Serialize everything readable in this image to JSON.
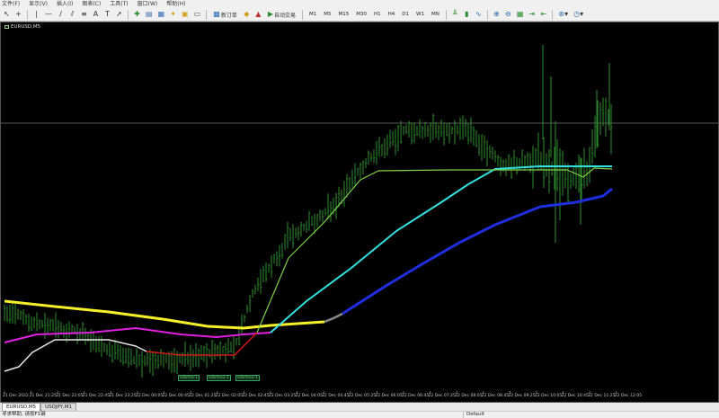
{
  "menu": [
    "文件(F)",
    "显示(V)",
    "插入(I)",
    "图表(C)",
    "工具(T)",
    "窗口(W)",
    "帮助(H)"
  ],
  "toolbar": {
    "new_order_label": "新订单",
    "autotrading_label": "自动交易",
    "periods": [
      "M1",
      "M5",
      "M15",
      "M30",
      "H1",
      "H4",
      "D1",
      "W1",
      "MN"
    ]
  },
  "chart": {
    "title": "EURUSD,M5",
    "time_labels": [
      "21 Dec 2022",
      "21 Dec 21:25",
      "21 Dec 22:05",
      "21 Dec 22:45",
      "21 Dec 23:25",
      "22 Dec 00:05",
      "22 Dec 00:45",
      "22 Dec 01:25",
      "22 Dec 02:05",
      "22 Dec 02:45",
      "22 Dec 03:25",
      "22 Dec 04:05",
      "22 Dec 04:45",
      "22 Dec 05:25",
      "22 Dec 06:05",
      "22 Dec 06:45",
      "22 Dec 07:25",
      "22 Dec 08:05",
      "22 Dec 08:45",
      "22 Dec 09:25",
      "22 Dec 10:05",
      "22 Dec 10:45",
      "22 Dec 11:25",
      "22 Dec 12:05"
    ],
    "object_tags": [
      "sdsrma-1",
      "sdsrma2-1",
      "sdsrma3-1"
    ],
    "colors": {
      "background": "#000000",
      "bars": "#2e8b2e",
      "ma_fast": "#7fd14a",
      "ma_mid": "#33e0e0",
      "ma_slow": "#1f2fe0",
      "ma_yellow": "#f5f02a",
      "ma_magenta": "#e020e0",
      "ma_red": "#d01818",
      "level_line": "#5a5a5a"
    }
  },
  "tabs": [
    "EURUSD,M5",
    "USDJPY,M1"
  ],
  "status": {
    "help_text": "寻求帮助, 请按F1键",
    "profile": "Default"
  }
}
